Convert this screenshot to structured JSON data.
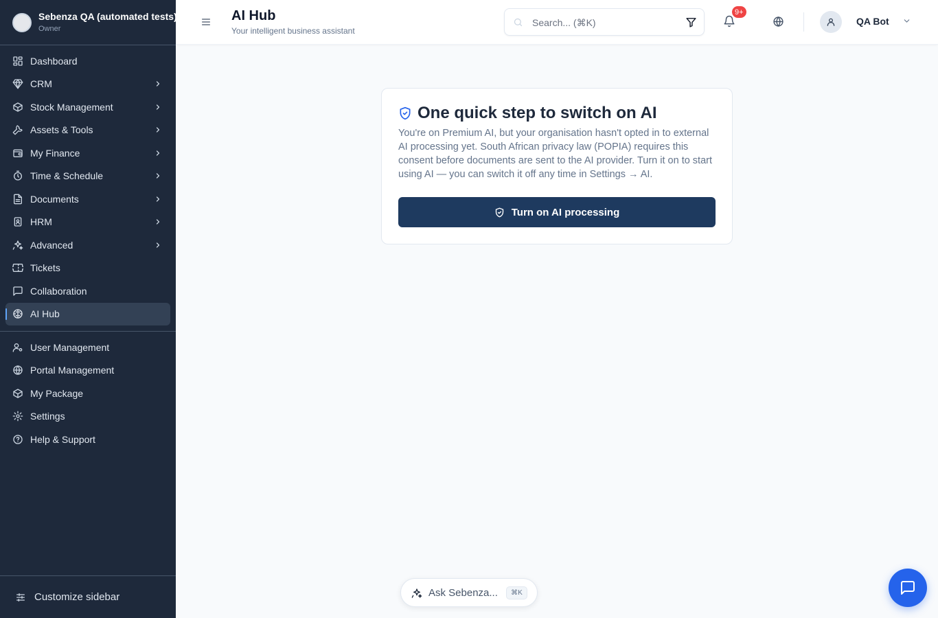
{
  "org": {
    "name": "Sebenza QA (automated tests)",
    "role": "Owner"
  },
  "sidebar": {
    "main_items": [
      {
        "label": "Dashboard",
        "icon": "dashboard-icon",
        "has_children": false
      },
      {
        "label": "CRM",
        "icon": "gem-icon",
        "has_children": true
      },
      {
        "label": "Stock Management",
        "icon": "package-icon",
        "has_children": true
      },
      {
        "label": "Assets & Tools",
        "icon": "wrench-icon",
        "has_children": true
      },
      {
        "label": "My Finance",
        "icon": "wallet-icon",
        "has_children": true
      },
      {
        "label": "Time & Schedule",
        "icon": "timer-icon",
        "has_children": true
      },
      {
        "label": "Documents",
        "icon": "document-icon",
        "has_children": true
      },
      {
        "label": "HRM",
        "icon": "id-badge-icon",
        "has_children": true
      },
      {
        "label": "Advanced",
        "icon": "sparkles-icon",
        "has_children": true
      },
      {
        "label": "Tickets",
        "icon": "ticket-icon",
        "has_children": false
      },
      {
        "label": "Collaboration",
        "icon": "message-square-icon",
        "has_children": false
      },
      {
        "label": "AI Hub",
        "icon": "ai-brain-icon",
        "has_children": false,
        "active": true
      }
    ],
    "bottom_items": [
      {
        "label": "User Management",
        "icon": "user-cog-icon"
      },
      {
        "label": "Portal Management",
        "icon": "globe-icon"
      },
      {
        "label": "My Package",
        "icon": "package-icon"
      },
      {
        "label": "Settings",
        "icon": "gear-icon"
      },
      {
        "label": "Help & Support",
        "icon": "help-circle-icon"
      }
    ],
    "customize_label": "Customize sidebar"
  },
  "header": {
    "title": "AI Hub",
    "subtitle": "Your intelligent business assistant",
    "search_placeholder": "Search... (⌘K)",
    "notification_badge": "9+",
    "user_name": "QA Bot"
  },
  "card": {
    "title": "One quick step to switch on AI",
    "body": "You're on Premium AI, but your organisation hasn't opted in to external AI processing yet. South African privacy law (POPIA) requires this consent before documents are sent to the AI provider. Turn it on to start using AI — you can switch it off any time in Settings → AI.",
    "button_label": "Turn on AI processing"
  },
  "ask": {
    "label": "Ask Sebenza...",
    "shortcut": "⌘K"
  },
  "colors": {
    "sidebar_bg": "#1e293b",
    "active_item_bg": "#334155",
    "primary_button": "#1e3a5f",
    "chat_fab": "#2563eb",
    "badge": "#ef4444",
    "accent_icon": "#2563eb"
  }
}
